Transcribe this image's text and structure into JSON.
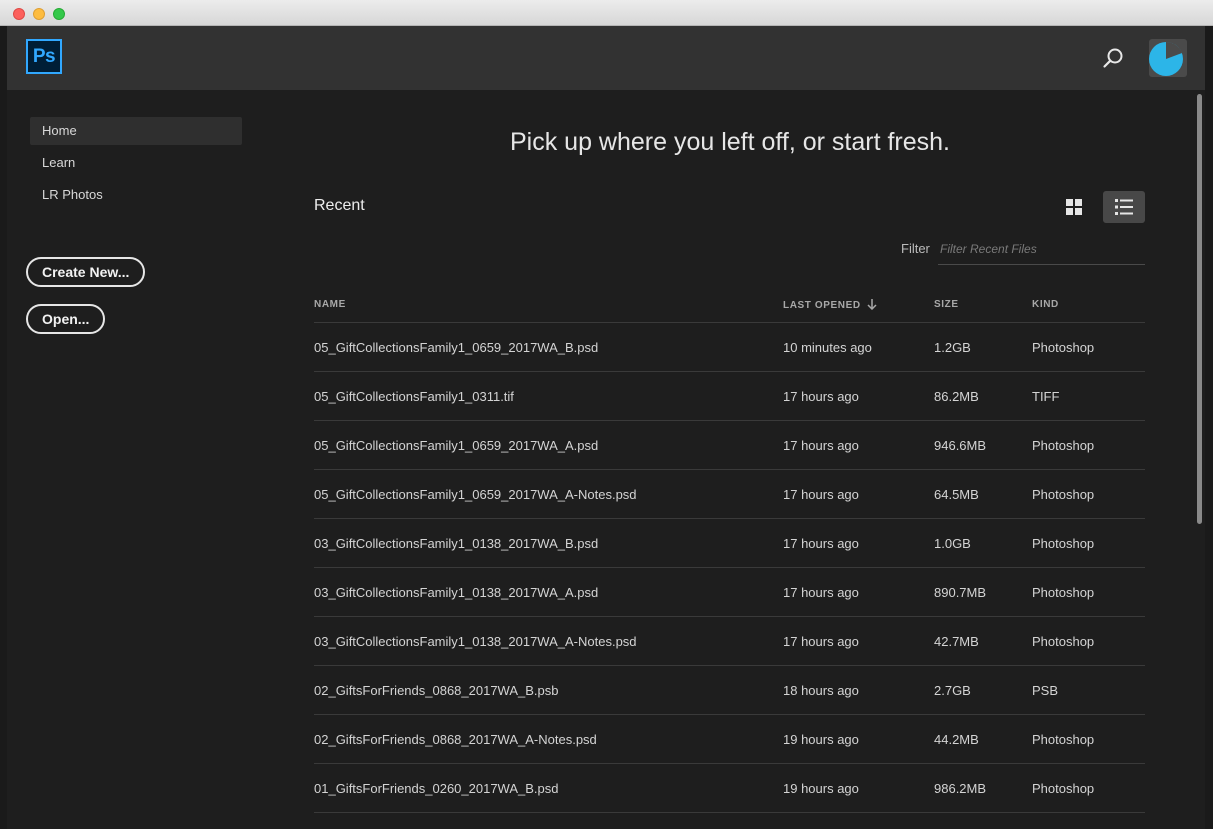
{
  "nav": {
    "items": [
      {
        "label": "Home"
      },
      {
        "label": "Learn"
      },
      {
        "label": "LR Photos"
      }
    ],
    "create_new_label": "Create New...",
    "open_label": "Open..."
  },
  "app": {
    "logo_text": "Ps"
  },
  "main": {
    "headline": "Pick up where you left off, or start fresh.",
    "recent_title": "Recent",
    "filter_label": "Filter",
    "filter_placeholder": "Filter Recent Files"
  },
  "table": {
    "headers": {
      "name": "NAME",
      "opened": "LAST OPENED",
      "size": "SIZE",
      "kind": "KIND"
    },
    "rows": [
      {
        "name": "05_GiftCollectionsFamily1_0659_2017WA_B.psd",
        "opened": "10 minutes ago",
        "size": "1.2GB",
        "kind": "Photoshop"
      },
      {
        "name": "05_GiftCollectionsFamily1_0311.tif",
        "opened": "17 hours ago",
        "size": "86.2MB",
        "kind": "TIFF"
      },
      {
        "name": "05_GiftCollectionsFamily1_0659_2017WA_A.psd",
        "opened": "17 hours ago",
        "size": "946.6MB",
        "kind": "Photoshop"
      },
      {
        "name": "05_GiftCollectionsFamily1_0659_2017WA_A-Notes.psd",
        "opened": "17 hours ago",
        "size": "64.5MB",
        "kind": "Photoshop"
      },
      {
        "name": "03_GiftCollectionsFamily1_0138_2017WA_B.psd",
        "opened": "17 hours ago",
        "size": "1.0GB",
        "kind": "Photoshop"
      },
      {
        "name": "03_GiftCollectionsFamily1_0138_2017WA_A.psd",
        "opened": "17 hours ago",
        "size": "890.7MB",
        "kind": "Photoshop"
      },
      {
        "name": "03_GiftCollectionsFamily1_0138_2017WA_A-Notes.psd",
        "opened": "17 hours ago",
        "size": "42.7MB",
        "kind": "Photoshop"
      },
      {
        "name": "02_GiftsForFriends_0868_2017WA_B.psb",
        "opened": "18 hours ago",
        "size": "2.7GB",
        "kind": "PSB"
      },
      {
        "name": "02_GiftsForFriends_0868_2017WA_A-Notes.psd",
        "opened": "19 hours ago",
        "size": "44.2MB",
        "kind": "Photoshop"
      },
      {
        "name": "01_GiftsForFriends_0260_2017WA_B.psd",
        "opened": "19 hours ago",
        "size": "986.2MB",
        "kind": "Photoshop"
      }
    ]
  },
  "icons": {
    "search": "search-icon",
    "grid_view": "grid-view-icon",
    "list_view": "list-view-icon",
    "sort": "sort-down-arrow-icon"
  },
  "colors": {
    "accent": "#31a8ff",
    "logo_bg": "#001e36",
    "avatar": "#2cb5e8"
  }
}
